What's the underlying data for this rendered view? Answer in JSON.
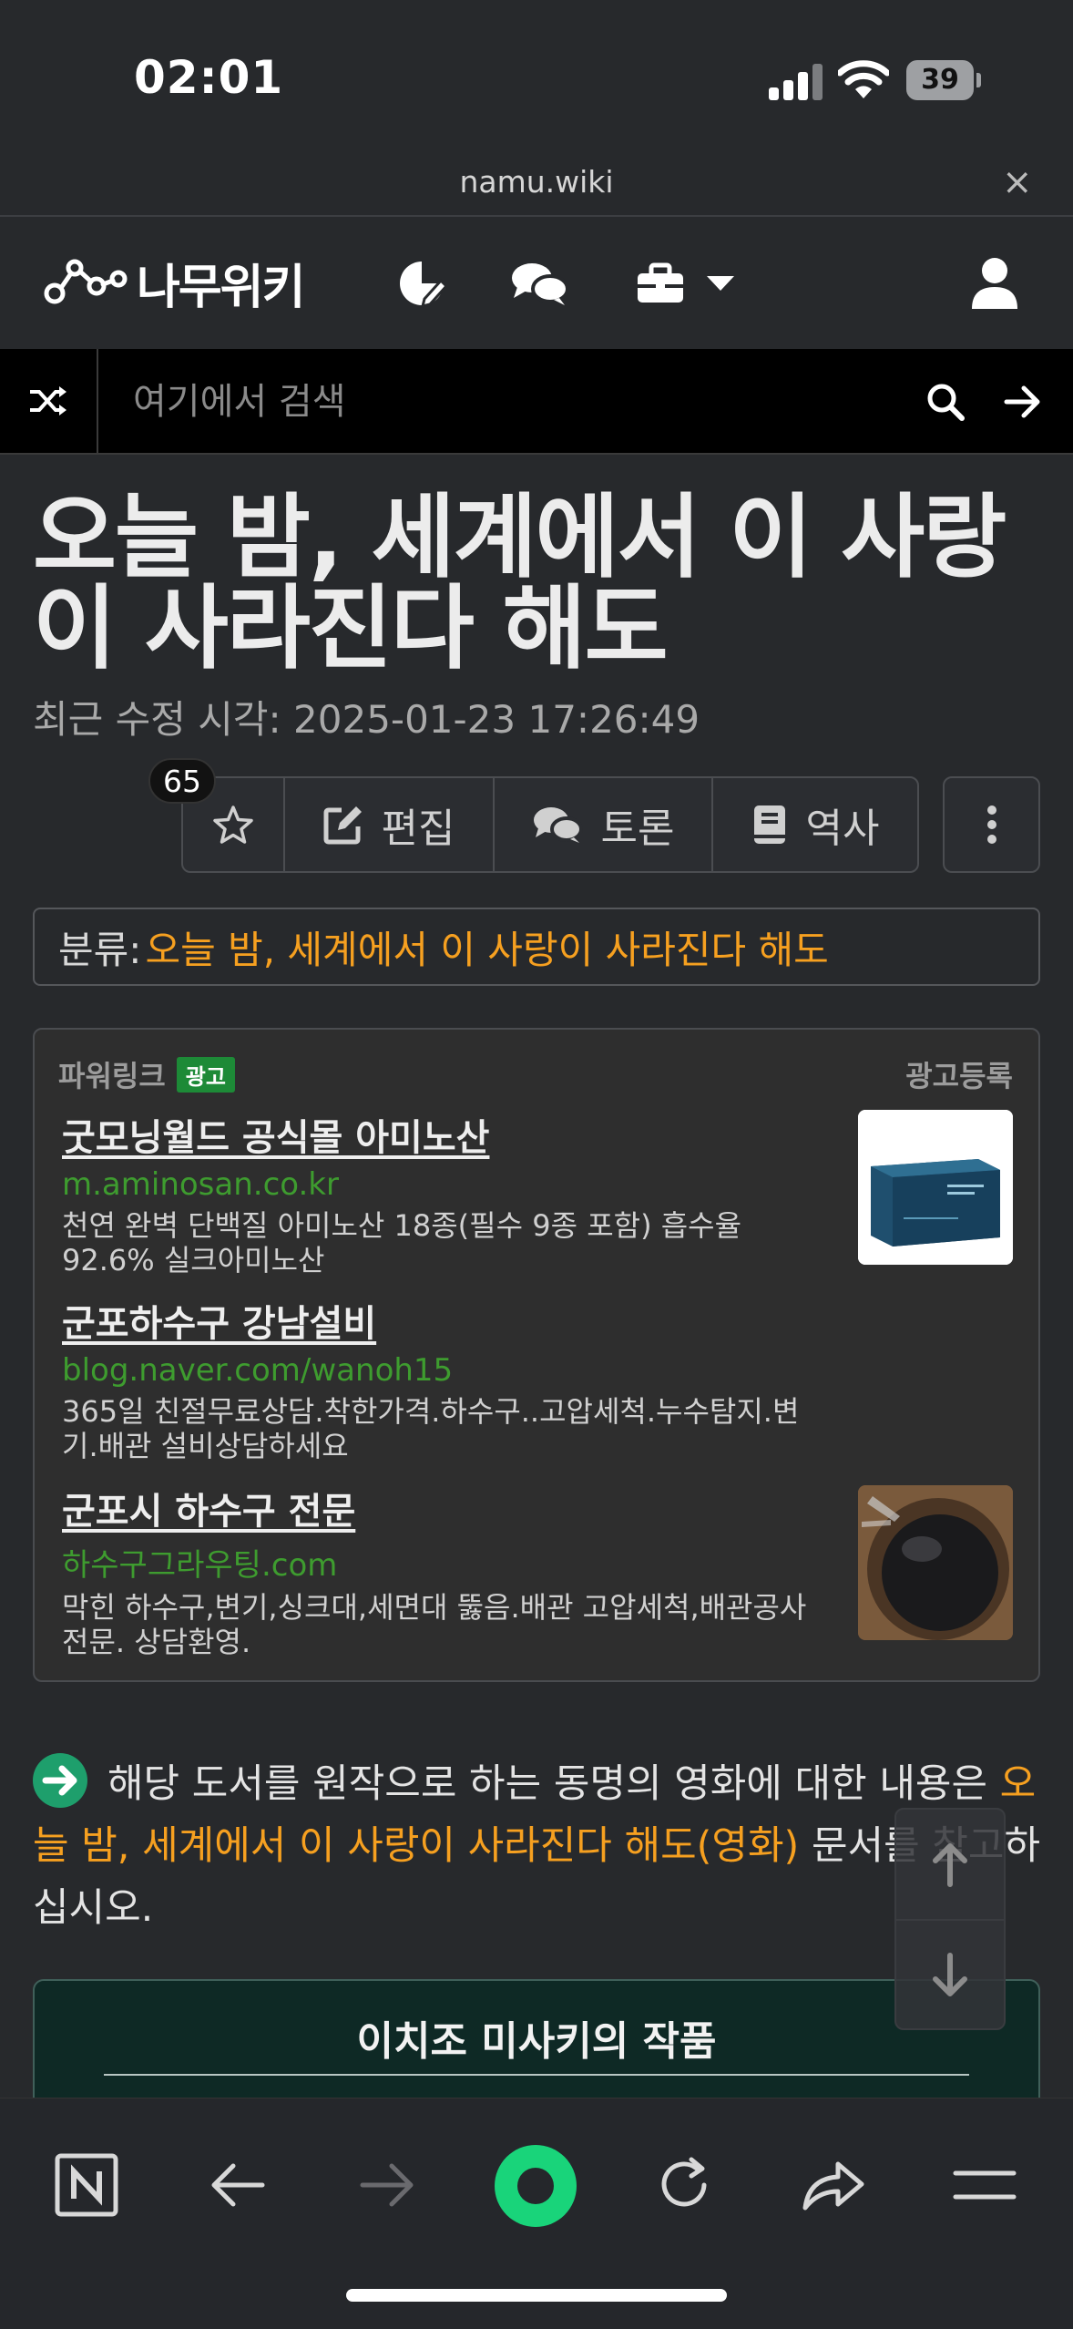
{
  "status_bar": {
    "time": "02:01",
    "battery": "39"
  },
  "browser": {
    "url": "namu.wiki",
    "close_glyph": "×"
  },
  "header": {
    "logo_text": "나무위키",
    "icons": [
      "recent-changes-icon",
      "discussion-icon",
      "tools-icon",
      "user-icon"
    ]
  },
  "search": {
    "placeholder": "여기에서 검색"
  },
  "article": {
    "title": "오늘 밤, 세계에서 이 사랑이 사라진다 해도",
    "modified_label": "최근 수정 시각: 2025-01-23 17:26:49",
    "star_count": "65",
    "toolbar": {
      "edit": "편집",
      "discuss": "토론",
      "history": "역사"
    },
    "category_label": "분류:",
    "category_value": "오늘 밤, 세계에서 이 사랑이 사라진다 해도"
  },
  "ad": {
    "header": "파워링크",
    "badge": "광고",
    "register": "광고등록",
    "items": [
      {
        "title": "굿모닝월드 공식몰 아미노산",
        "url": "m.aminosan.co.kr",
        "desc": "천연 완벽 단백질 아미노산 18종(필수 9종 포함) 흡수율 92.6% 실크아미노산"
      },
      {
        "title": "군포하수구 강남설비",
        "url": "blog.naver.com/wanoh15",
        "desc": "365일 친절무료상담.착한가격.하수구..고압세척.누수탐지.변기.배관 설비상담하세요"
      },
      {
        "title": "군포시 하수구 전문",
        "url": "하수구그라우팅.com",
        "desc": "막힌 하수구,변기,싱크대,세면대 뚫음.배관 고압세척,배관공사 전문. 상담환영."
      }
    ]
  },
  "notice": {
    "text_before": "해당 도서를 원작으로 하는 동명의 영화에 대한 내용은 ",
    "link": "오늘 밤, 세계에서 이 사랑이 사라진다 해도(영화)",
    "text_after": " 문서를 참고하십시오."
  },
  "works": {
    "title": "이치조 미사키의 작품"
  },
  "colors": {
    "background": "#27292c",
    "link_orange": "#f6a020",
    "ad_url_green": "#3e9c2f",
    "works_panel": "#0e2925",
    "notice_arrow": "#1e9f6c"
  }
}
